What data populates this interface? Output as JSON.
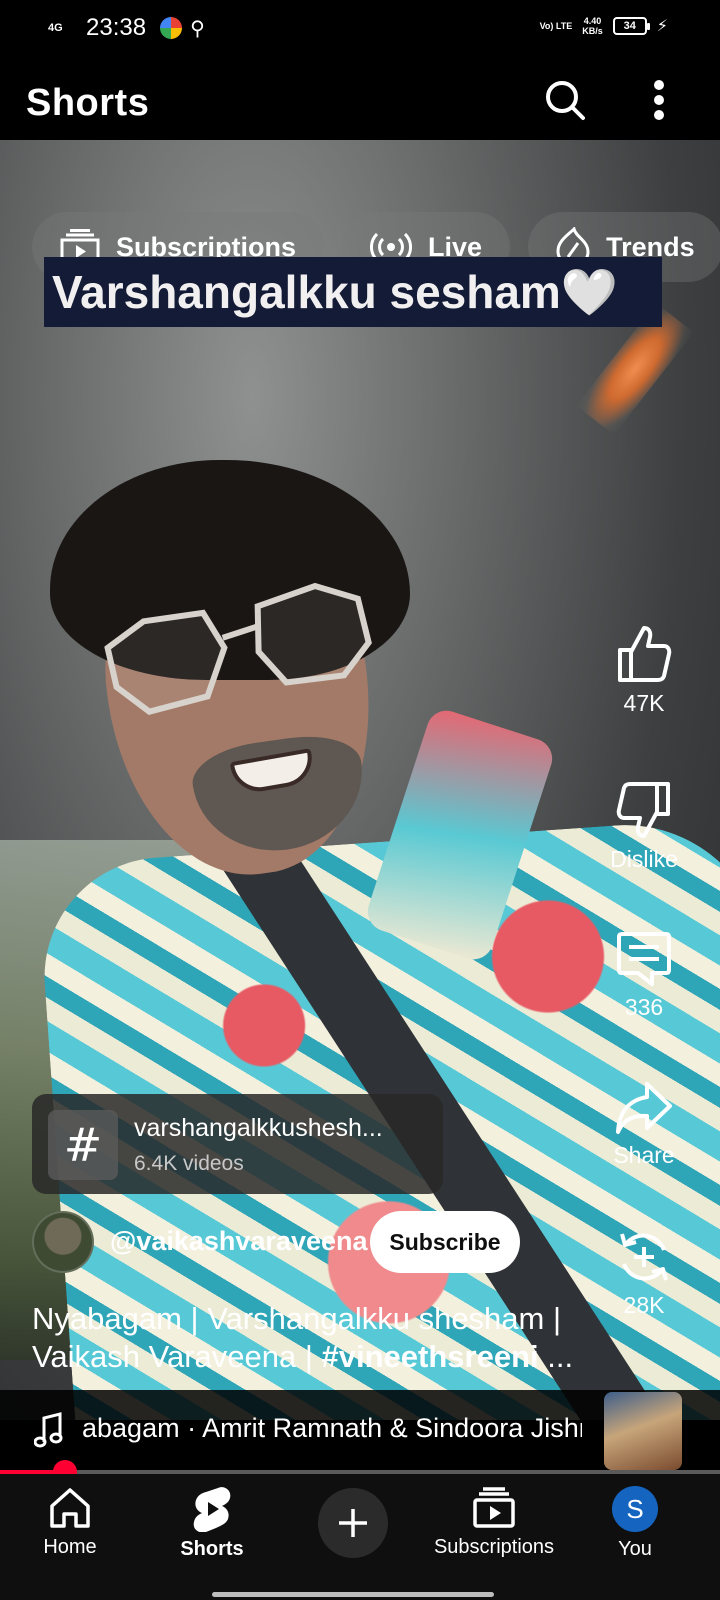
{
  "status_bar": {
    "network": "4G",
    "time": "23:38",
    "volte": "Vo) LTE",
    "speed_value": "4.40",
    "speed_unit": "KB/s",
    "battery": "34"
  },
  "app_bar": {
    "title": "Shorts",
    "search_icon": "search-icon",
    "more_icon": "more-vert-icon"
  },
  "chips": [
    {
      "label": "Subscriptions",
      "icon": "subscriptions-icon"
    },
    {
      "label": "Live",
      "icon": "live-icon"
    },
    {
      "label": "Trends",
      "icon": "trends-icon"
    }
  ],
  "video": {
    "caption_overlay": "Varshangalkku sesham🤍"
  },
  "actions": {
    "like": {
      "label": "47K",
      "icon": "thumb-up-icon"
    },
    "dislike": {
      "label": "Dislike",
      "icon": "thumb-down-icon"
    },
    "comments": {
      "label": "336",
      "icon": "comment-icon"
    },
    "share": {
      "label": "Share",
      "icon": "share-icon"
    },
    "remix": {
      "label": "28K",
      "icon": "remix-icon"
    }
  },
  "hashtag": {
    "symbol": "#",
    "name": "varshangalkkushesh...",
    "count": "6.4K videos"
  },
  "channel": {
    "handle": "@vaikashvaraveena",
    "subscribe_label": "Subscribe"
  },
  "title": {
    "line1": "Nyabagam | Varshangalkku shesham |",
    "line2_prefix": "Vaikash Varaveena | ",
    "line2_hashtag": "#vineethsreeni",
    "line2_suffix": " ..."
  },
  "music": {
    "text": "abagam · Amrit Ramnath & Sindoora Jishnu",
    "icon": "music-note-icon"
  },
  "progress": {
    "fraction": 0.09
  },
  "bottom_nav": {
    "home": "Home",
    "shorts": "Shorts",
    "create_icon": "plus-icon",
    "subscriptions": "Subscriptions",
    "you": "You",
    "you_initial": "S"
  },
  "colors": {
    "accent": "#ff0033",
    "avatar_blue": "#1565c0"
  }
}
